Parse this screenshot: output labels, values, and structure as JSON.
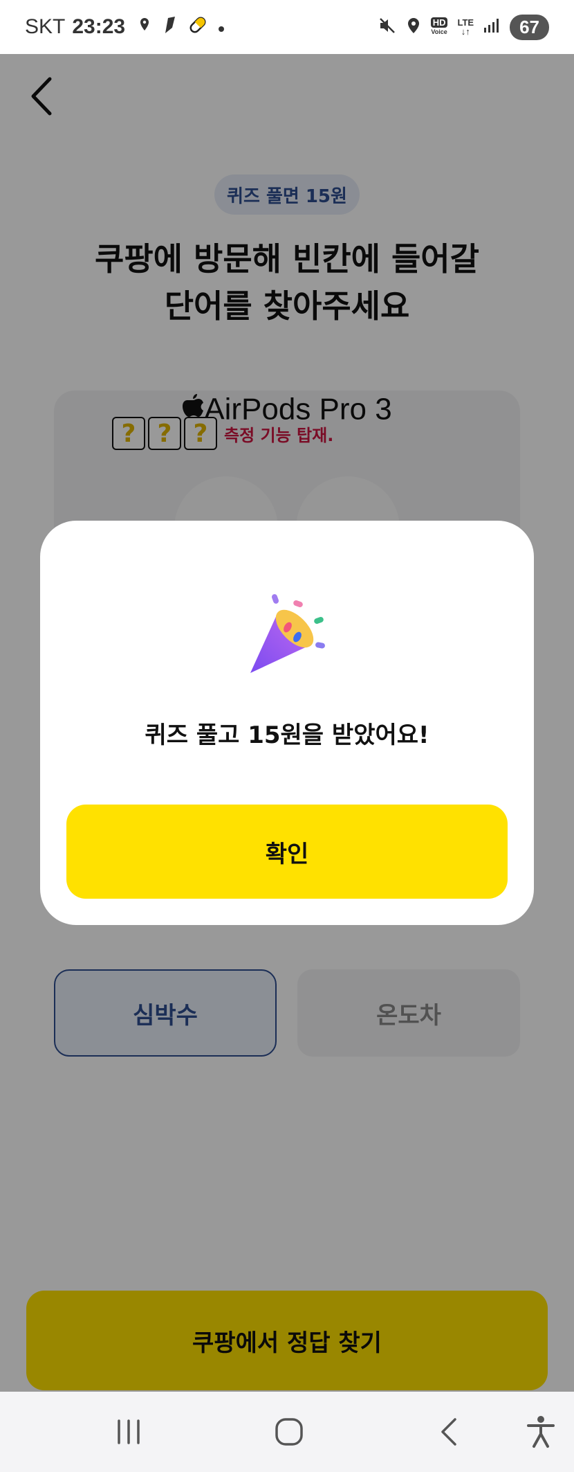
{
  "status_bar": {
    "carrier": "SKT",
    "time": "23:23",
    "hd_label": "HD",
    "voice_label": "Voice",
    "lte_label": "LTE",
    "battery": "67"
  },
  "page": {
    "reward_pill": "퀴즈 풀면 15원",
    "headline_line1": "쿠팡에 방문해 빈칸에 들어갈",
    "headline_line2": "단어를 찾아주세요",
    "product_title": "AirPods Pro 3",
    "quiz_boxes": [
      "?",
      "?",
      "?"
    ],
    "quiz_suffix": "측정 기능 탑재.",
    "answers": [
      {
        "label": "심박수",
        "selected": true
      },
      {
        "label": "온도차",
        "selected": false
      }
    ],
    "cta_label": "쿠팡에서 정답 찾기"
  },
  "modal": {
    "message": "퀴즈 풀고 15원을 받았어요!",
    "confirm_label": "확인",
    "icon": "party-popper-icon"
  },
  "colors": {
    "accent_yellow": "#ffe100",
    "navy": "#2d4d8f",
    "red_text": "#cc1540"
  }
}
